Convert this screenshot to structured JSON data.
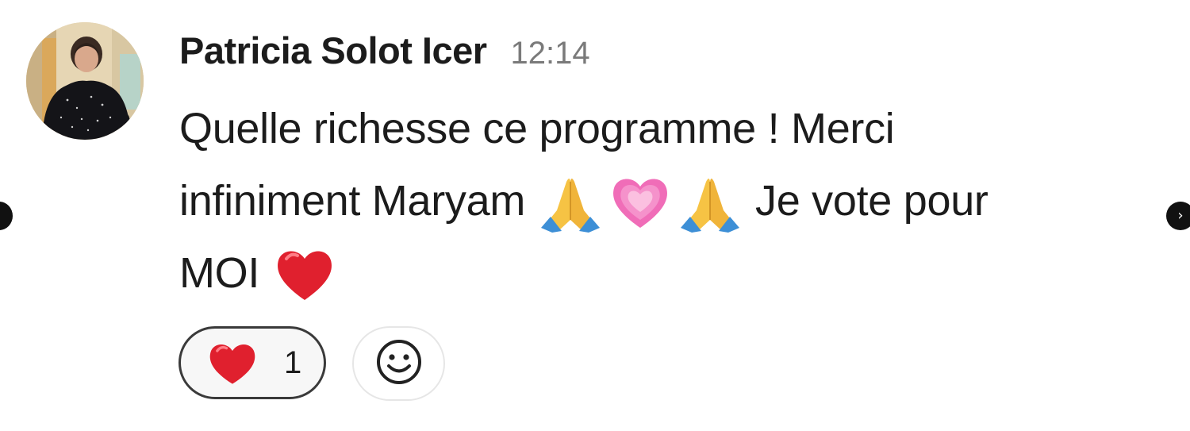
{
  "comment": {
    "author": "Patricia Solot Icer",
    "time": "12:14",
    "lines": [
      [
        "Quelle richesse ce programme ! Merci"
      ],
      [
        "infiniment Maryam",
        "Je vote pour"
      ],
      [
        "MOI"
      ]
    ]
  },
  "message_emojis": [
    "folded-hands",
    "growing-heart",
    "folded-hands",
    "red-heart"
  ],
  "reactions": [
    {
      "emoji": "red-heart",
      "count": "1"
    }
  ],
  "icons": {
    "add_reaction": "smiley-icon",
    "nav_prev": "chevron-left-icon",
    "nav_next": "chevron-right-icon"
  },
  "nav": {
    "next_glyph": "›"
  },
  "colors": {
    "text": "#1c1c1c",
    "timestamp": "#7a7a7a",
    "heart": "#e0202e",
    "pink_heart": "#ee5fb0",
    "nav_button": "#111111"
  }
}
